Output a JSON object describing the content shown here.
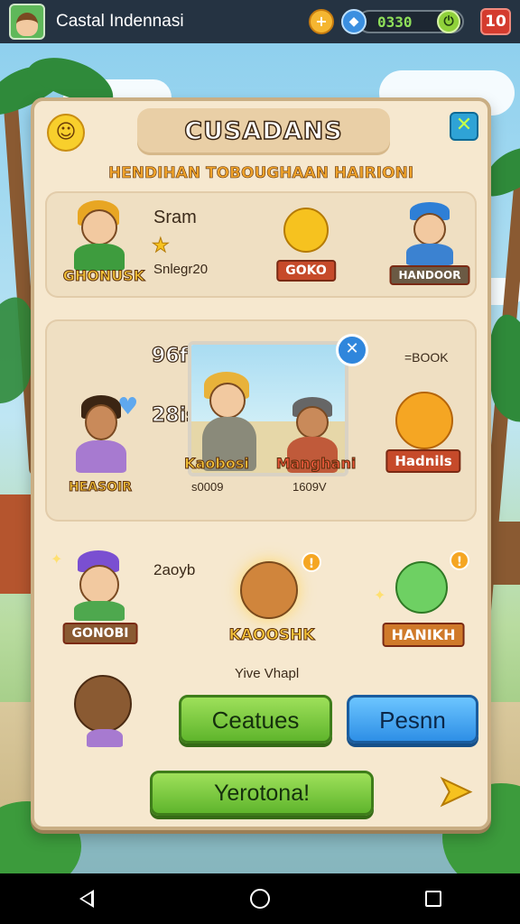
{
  "status_bar": {
    "app_title": "Castal Indennasi",
    "coin_icon": "coin-icon",
    "gem_icon": "gem-icon",
    "score": "0330",
    "level": "10"
  },
  "dialog": {
    "title": "CUSADANS",
    "subtitle": "HENDIHAN TOBOUGHAAN HAIRIONI",
    "close_symbol": "✕",
    "top_row": {
      "left_character": {
        "name": "GHONUSK",
        "label": "Sram",
        "sublabel": "Snlegr20"
      },
      "middle_character": {
        "name": "GOKO"
      },
      "right_character": {
        "name": "HANDOOR"
      }
    },
    "middle_row": {
      "top_number": "96fe",
      "right_top_text": "=BOOK",
      "second_number": "28is",
      "left_character": {
        "name": "HEASOIR"
      },
      "photo_left": {
        "name": "Kaobosi",
        "caption": "s0009"
      },
      "photo_right": {
        "name": "Manghani",
        "caption": "1609V"
      },
      "right_character": {
        "name": "Hadnils"
      }
    },
    "bottom_row": {
      "label": "2aoyb",
      "left_character": {
        "name": "GONOBI"
      },
      "middle_character": {
        "name": "KAOOSHK"
      },
      "right_character": {
        "name": "HANIKH"
      },
      "caption": "Yive Vhapl"
    },
    "buttons": {
      "green": "Ceatues",
      "blue": "Pesnn",
      "wide": "Yerotona!"
    }
  },
  "colors": {
    "panel_bg": "#f6e8cf",
    "accent_green": "#5fb52c",
    "accent_blue": "#2e8fe6",
    "title_orange": "#f0a32a"
  }
}
